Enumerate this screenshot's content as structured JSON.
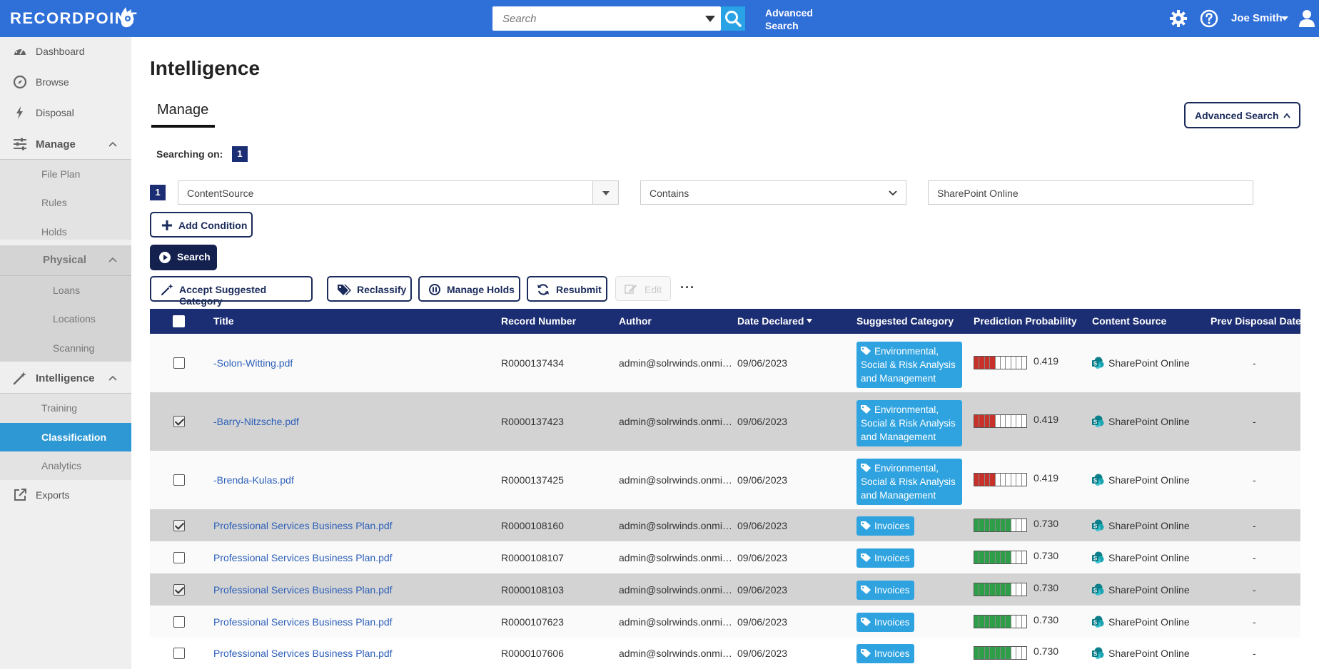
{
  "app": {
    "logo": "RECORDPOINT",
    "search_placeholder": "Search",
    "advanced_search_line1": "Advanced",
    "advanced_search_line2": "Search",
    "user_name": "Joe Smith"
  },
  "sidebar": {
    "items": [
      {
        "label": "Dashboard",
        "icon": "dashboard-icon"
      },
      {
        "label": "Browse",
        "icon": "compass-icon"
      },
      {
        "label": "Disposal",
        "icon": "lightning-icon"
      },
      {
        "label": "Manage",
        "icon": "sliders-icon"
      },
      {
        "label": "File Plan"
      },
      {
        "label": "Rules"
      },
      {
        "label": "Holds"
      },
      {
        "label": "Physical"
      },
      {
        "label": "Loans"
      },
      {
        "label": "Locations"
      },
      {
        "label": "Scanning"
      },
      {
        "label": "Intelligence",
        "icon": "magic-wand-icon"
      },
      {
        "label": "Training"
      },
      {
        "label": "Classification"
      },
      {
        "label": "Analytics"
      },
      {
        "label": "Exports",
        "icon": "external-link-icon"
      }
    ]
  },
  "main": {
    "title": "Intelligence",
    "tab": "Manage",
    "advanced_search_button": "Advanced Search",
    "searching_on_label": "Searching on:",
    "searching_on_count": "1",
    "condition": {
      "index": "1",
      "field": "ContentSource",
      "operator": "Contains",
      "value": "SharePoint Online"
    },
    "add_condition": "Add Condition",
    "search_button": "Search",
    "actions": {
      "accept": "Accept Suggested Category",
      "reclassify": "Reclassify",
      "manage_holds": "Manage Holds",
      "resubmit": "Resubmit",
      "edit": "Edit",
      "more": "···"
    }
  },
  "table": {
    "columns": [
      "Title",
      "Record Number",
      "Author",
      "Date Declared",
      "Suggested Category",
      "Prediction Probability",
      "Content Source",
      "Prev Disposal Date"
    ],
    "rows": [
      {
        "checked": false,
        "title": "-Solon-Witting.pdf",
        "record": "R0000137434",
        "author": "admin@solrwinds.onmi…",
        "date": "09/06/2023",
        "category": "Environmental, Social & Risk Analysis and Management",
        "prob": "0.419",
        "prob_value": 0.419,
        "source": "SharePoint Online",
        "prev": "-"
      },
      {
        "checked": true,
        "title": "-Barry-Nitzsche.pdf",
        "record": "R0000137423",
        "author": "admin@solrwinds.onmi…",
        "date": "09/06/2023",
        "category": "Environmental, Social & Risk Analysis and Management",
        "prob": "0.419",
        "prob_value": 0.419,
        "source": "SharePoint Online",
        "prev": "-"
      },
      {
        "checked": false,
        "title": "-Brenda-Kulas.pdf",
        "record": "R0000137425",
        "author": "admin@solrwinds.onmi…",
        "date": "09/06/2023",
        "category": "Environmental, Social & Risk Analysis and Management",
        "prob": "0.419",
        "prob_value": 0.419,
        "source": "SharePoint Online",
        "prev": "-"
      },
      {
        "checked": true,
        "title": "Professional Services Business Plan.pdf",
        "record": "R0000108160",
        "author": "admin@solrwinds.onmi…",
        "date": "09/06/2023",
        "category": "Invoices",
        "prob": "0.730",
        "prob_value": 0.73,
        "source": "SharePoint Online",
        "prev": "-"
      },
      {
        "checked": false,
        "title": "Professional Services Business Plan.pdf",
        "record": "R0000108107",
        "author": "admin@solrwinds.onmi…",
        "date": "09/06/2023",
        "category": "Invoices",
        "prob": "0.730",
        "prob_value": 0.73,
        "source": "SharePoint Online",
        "prev": "-"
      },
      {
        "checked": true,
        "title": "Professional Services Business Plan.pdf",
        "record": "R0000108103",
        "author": "admin@solrwinds.onmi…",
        "date": "09/06/2023",
        "category": "Invoices",
        "prob": "0.730",
        "prob_value": 0.73,
        "source": "SharePoint Online",
        "prev": "-"
      },
      {
        "checked": false,
        "title": "Professional Services Business Plan.pdf",
        "record": "R0000107623",
        "author": "admin@solrwinds.onmi…",
        "date": "09/06/2023",
        "category": "Invoices",
        "prob": "0.730",
        "prob_value": 0.73,
        "source": "SharePoint Online",
        "prev": "-"
      },
      {
        "checked": false,
        "title": "Professional Services Business Plan.pdf",
        "record": "R0000107606",
        "author": "admin@solrwinds.onmi…",
        "date": "09/06/2023",
        "category": "Invoices",
        "prob": "0.730",
        "prob_value": 0.73,
        "source": "SharePoint Online",
        "prev": "-"
      }
    ]
  },
  "colors": {
    "topbar": "#2f6fd8",
    "header_navy": "#1c2e73",
    "active_nav": "#2d98d4",
    "badge_blue": "#2fa3e0",
    "prob_low": "#c8302a",
    "prob_high": "#2e9e48",
    "link": "#2c5fb8"
  }
}
